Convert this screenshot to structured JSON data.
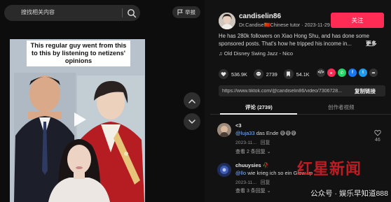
{
  "search": {
    "placeholder": "搜找相关内容",
    "icon": "search-icon"
  },
  "report": {
    "label": "举报",
    "icon": "flag-icon"
  },
  "video": {
    "caption": "This regular guy went from this to this by listening to netizens' opinions",
    "play_icon": "play-icon"
  },
  "nav": {
    "up_icon": "chevron-up-icon",
    "down_icon": "chevron-down-icon"
  },
  "author": {
    "username": "candiselin86",
    "handle_prefix": "Dr.Candise",
    "flag": "🇨🇳",
    "handle_suffix": "Chinese tutor",
    "date": "2023-11-29",
    "follow_label": "关注"
  },
  "description": {
    "text": "He has 280k followers on Xiao Hong Shu, and has done some sponsored posts. That's how he tripped his income in...",
    "more_label": "更多"
  },
  "music": {
    "icon": "music-note-icon",
    "text": "Old Disney Swing Jazz - Nico"
  },
  "stats": {
    "likes": "536.9K",
    "comments": "2739",
    "saves": "54.1K"
  },
  "share": {
    "icons": [
      "embed-icon",
      "pink-share-icon",
      "whatsapp-icon",
      "facebook-icon",
      "twitter-icon",
      "forward-icon"
    ],
    "colors": [
      "#333333",
      "#fe2c55",
      "#25d366",
      "#1877f2",
      "#1d9bf0",
      "#333333"
    ]
  },
  "link": {
    "url": "https://www.tiktok.com/@candiselin86/video/7306728...",
    "copy_label": "复制链接"
  },
  "tabs": {
    "comments_label": "评论 (2739)",
    "creator_videos_label": "创作者视频"
  },
  "comments": [
    {
      "mention": "@luja33",
      "text": " das Ende 😅😅😅",
      "date": "2023-11...",
      "reply_label": "回复",
      "likes": "46",
      "more_label": "查看 2 条回复 ⌄"
    },
    {
      "name": "chuuysies 🥀",
      "mention": "@llo",
      "text": " wie krieg ich so ein Glow up",
      "date": "2023-11...",
      "reply_label": "回复",
      "more_label": "查看 3 条回复 ⌄"
    }
  ],
  "comment_1": {
    "name": "<3"
  },
  "watermark": {
    "text": "公众号 · 娱乐早知道888",
    "logo_text": "红星新闻"
  },
  "colors": {
    "accent": "#fe2c55",
    "background": "#121212"
  }
}
